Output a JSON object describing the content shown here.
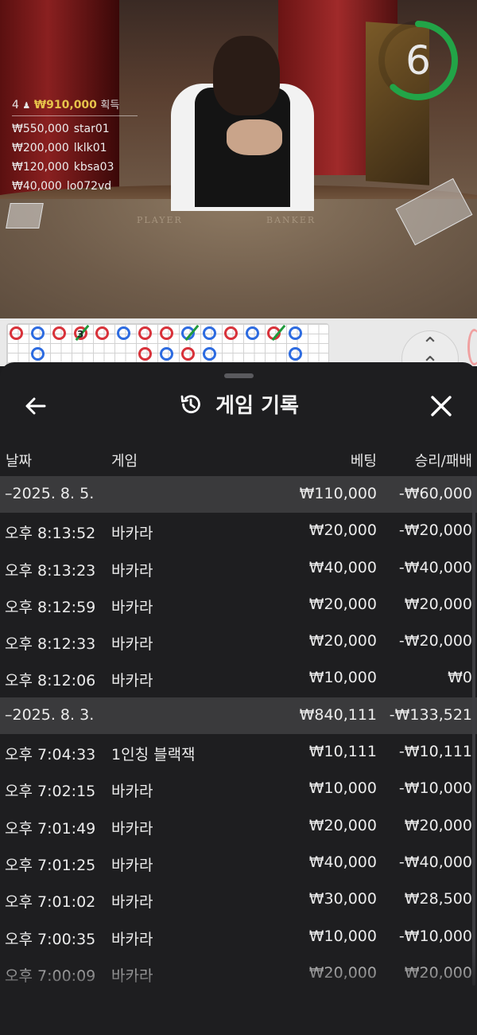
{
  "video": {
    "table_labels": {
      "player": "PLAYER",
      "banker": "BANKER"
    },
    "timer": {
      "value": "6",
      "progress": 0.62,
      "color": "#22a447"
    },
    "winners": {
      "count": "4",
      "total": "₩910,000",
      "total_label": "획득",
      "entries": [
        {
          "amount": "₩550,000",
          "name": "star01"
        },
        {
          "amount": "₩200,000",
          "name": "lklk01"
        },
        {
          "amount": "₩120,000",
          "name": "kbsa03"
        },
        {
          "amount": "₩40,000",
          "name": "lo072vd"
        }
      ]
    }
  },
  "road": {
    "colors": {
      "player": "#2d6be0",
      "banker": "#d8323a",
      "tie": "#1f9a3c"
    },
    "marker_number": "3",
    "expand_icon": "double-chevron-up-icon"
  },
  "sheet": {
    "title": "게임 기록",
    "title_icon": "history-icon",
    "back_icon": "arrow-left-icon",
    "close_icon": "close-icon",
    "headers": {
      "date": "날짜",
      "game": "게임",
      "bet": "베팅",
      "win": "승리/패배"
    },
    "rows": [
      {
        "type": "group",
        "date": "–2025. 8. 5.",
        "bet": "₩110,000",
        "win": "-₩60,000"
      },
      {
        "type": "item",
        "time": "오후 8:13:52",
        "game": "바카라",
        "bet": "₩20,000",
        "win": "-₩20,000"
      },
      {
        "type": "item",
        "time": "오후 8:13:23",
        "game": "바카라",
        "bet": "₩40,000",
        "win": "-₩40,000"
      },
      {
        "type": "item",
        "time": "오후 8:12:59",
        "game": "바카라",
        "bet": "₩20,000",
        "win": "₩20,000"
      },
      {
        "type": "item",
        "time": "오후 8:12:33",
        "game": "바카라",
        "bet": "₩20,000",
        "win": "-₩20,000"
      },
      {
        "type": "item",
        "time": "오후 8:12:06",
        "game": "바카라",
        "bet": "₩10,000",
        "win": "₩0"
      },
      {
        "type": "group",
        "date": "–2025. 8. 3.",
        "bet": "₩840,111",
        "win": "-₩133,521"
      },
      {
        "type": "item",
        "time": "오후 7:04:33",
        "game": "1인칭 블랙잭",
        "bet": "₩10,111",
        "win": "-₩10,111"
      },
      {
        "type": "item",
        "time": "오후 7:02:15",
        "game": "바카라",
        "bet": "₩10,000",
        "win": "-₩10,000"
      },
      {
        "type": "item",
        "time": "오후 7:01:49",
        "game": "바카라",
        "bet": "₩20,000",
        "win": "₩20,000"
      },
      {
        "type": "item",
        "time": "오후 7:01:25",
        "game": "바카라",
        "bet": "₩40,000",
        "win": "-₩40,000"
      },
      {
        "type": "item",
        "time": "오후 7:01:02",
        "game": "바카라",
        "bet": "₩30,000",
        "win": "₩28,500"
      },
      {
        "type": "item",
        "time": "오후 7:00:35",
        "game": "바카라",
        "bet": "₩10,000",
        "win": "-₩10,000"
      },
      {
        "type": "item",
        "time": "오후 7:00:09",
        "game": "바카라",
        "bet": "₩20,000",
        "win": "₩20,000"
      }
    ]
  }
}
